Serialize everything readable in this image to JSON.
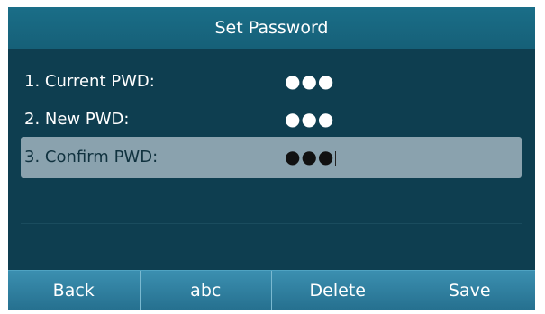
{
  "title": "Set Password",
  "fields": [
    {
      "label": "1. Current PWD:",
      "value": "●●●"
    },
    {
      "label": "2. New PWD:",
      "value": "●●●"
    },
    {
      "label": "3. Confirm PWD:",
      "value": "●●●"
    }
  ],
  "softkeys": {
    "back": "Back",
    "abc": "abc",
    "delete": "Delete",
    "save": "Save"
  },
  "colors": {
    "screen_bg": "#0e3e50",
    "title_bar": "#1a6e88",
    "selected_row": "#8aa2ae",
    "softkey_bar": "#3b8fb0"
  }
}
